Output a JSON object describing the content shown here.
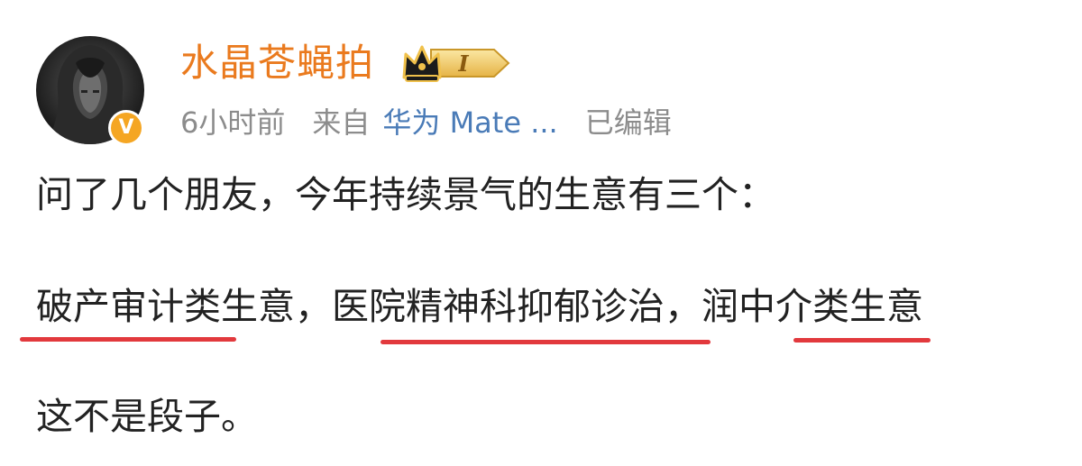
{
  "post": {
    "author": {
      "name": "水晶苍蝇拍",
      "verified_badge": "V",
      "member_level": "I",
      "avatar_icon": "hooded-figure-avatar-icon",
      "badge_icon": "crown-icon"
    },
    "meta": {
      "time": "6小时前",
      "source_prefix": "来自",
      "device": "华为 Mate ...",
      "edited": "已编辑"
    },
    "content": {
      "line1": "问了几个朋友，今年持续景气的生意有三个：",
      "line2": {
        "part1": "破产审计类生意",
        "sep1": "，",
        "part2": "医院精神科抑郁诊治",
        "sep2": "，",
        "part3": "润中介类生意"
      },
      "line3": "这不是段子。"
    }
  },
  "colors": {
    "username": "#ea7a1e",
    "meta_text": "#8c8c8c",
    "device_link": "#4a7bb7",
    "body_text": "#222222",
    "underline": "#e2393d",
    "vip_badge": "#f5a623"
  }
}
